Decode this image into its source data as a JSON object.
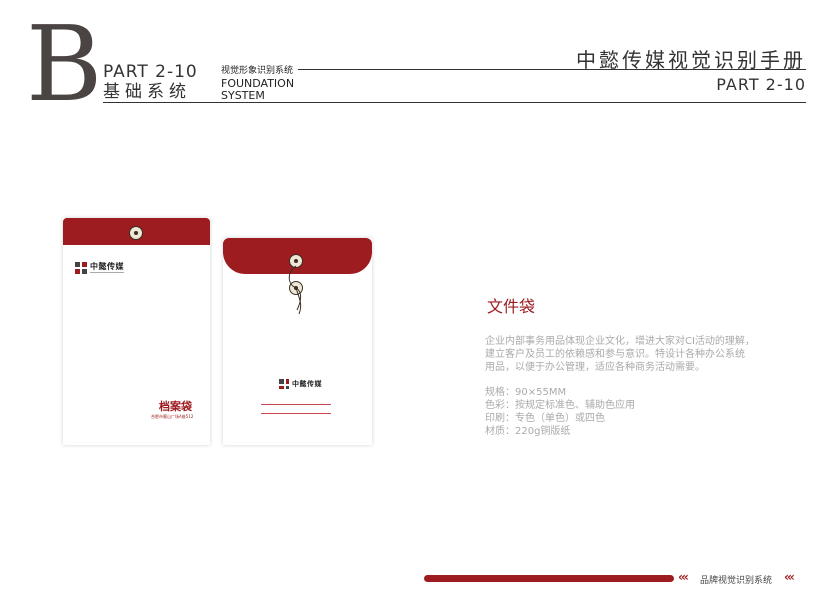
{
  "header": {
    "letter": "B",
    "part": "PART 2-10",
    "section_cn": "基础系统",
    "sub_cn": "视觉形象识别系统",
    "sub_en_1": "FOUNDATION",
    "sub_en_2": "SYSTEM",
    "manual_title": "中懿传媒视觉识别手册",
    "manual_part": "PART 2-10"
  },
  "envelope_front": {
    "logo_text": "中懿传媒",
    "label": "档案袋",
    "label_sub": "合肥市蜀山广场A座512"
  },
  "envelope_back": {
    "logo_text": "中懿传媒"
  },
  "content": {
    "title": "文件袋",
    "desc_lines": [
      "企业内部事务用品体现企业文化，增进大家对CI活动的理解，",
      "建立客户及员工的依赖感和参与意识。特设计各种办公系统",
      "用品，以便于办公管理，适应各种商务活动需要。"
    ],
    "specs": [
      "规格：90×55MM",
      "色彩：按规定标准色、辅助色应用",
      "印刷：专色（单色）或四色",
      "材质：220g铜版纸"
    ]
  },
  "footer": {
    "label": "品牌视觉识别系统",
    "chev_left": "‹‹‹",
    "chev_right": "‹‹‹"
  },
  "colors": {
    "brand": "#9c1c20",
    "text": "#333333",
    "muted": "#aaaaaa"
  }
}
